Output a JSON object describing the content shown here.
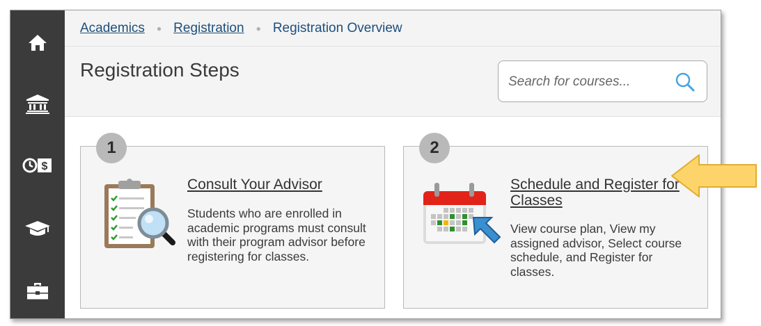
{
  "breadcrumb": {
    "items": [
      "Academics",
      "Registration"
    ],
    "current": "Registration Overview"
  },
  "page": {
    "title": "Registration Steps"
  },
  "search": {
    "placeholder": "Search for courses..."
  },
  "sidebar": {
    "icons": [
      "home-icon",
      "institution-icon",
      "finance-icon",
      "graduation-cap-icon",
      "briefcase-icon"
    ]
  },
  "steps": [
    {
      "number": "1",
      "title": "Consult Your Advisor",
      "description": "Students who are enrolled in academic programs must consult with their program advisor before registering for classes.",
      "icon": "clipboard-magnifier-icon"
    },
    {
      "number": "2",
      "title": "Schedule and Register for Classes",
      "description": "View course plan, View my assigned advisor, Select course schedule, and Register for classes.",
      "icon": "calendar-cursor-icon"
    }
  ],
  "colors": {
    "sidebar": "#3b3b3b",
    "link": "#1d4f7c",
    "badge": "#b9b9b9",
    "arrow": "#fcd46a",
    "search_icon": "#4aa3df"
  }
}
